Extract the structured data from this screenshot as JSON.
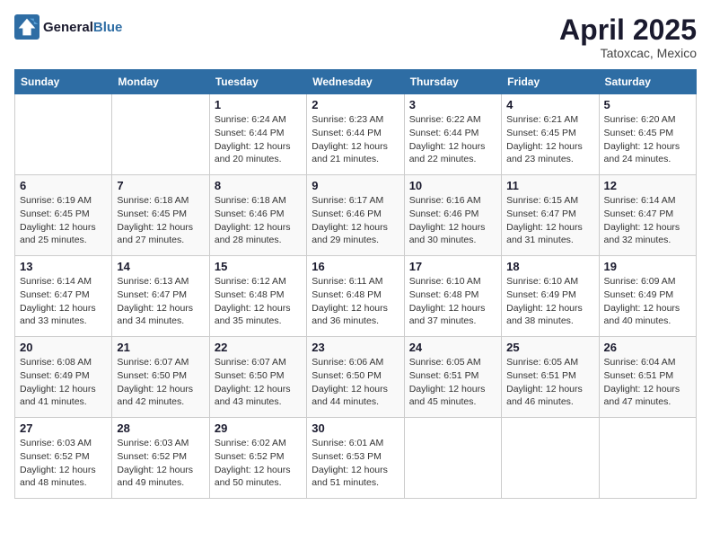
{
  "header": {
    "logo_line1": "General",
    "logo_line2": "Blue",
    "month": "April 2025",
    "location": "Tatoxcac, Mexico"
  },
  "days_of_week": [
    "Sunday",
    "Monday",
    "Tuesday",
    "Wednesday",
    "Thursday",
    "Friday",
    "Saturday"
  ],
  "weeks": [
    [
      {
        "day": "",
        "sunrise": "",
        "sunset": "",
        "daylight": ""
      },
      {
        "day": "",
        "sunrise": "",
        "sunset": "",
        "daylight": ""
      },
      {
        "day": "1",
        "sunrise": "Sunrise: 6:24 AM",
        "sunset": "Sunset: 6:44 PM",
        "daylight": "Daylight: 12 hours and 20 minutes."
      },
      {
        "day": "2",
        "sunrise": "Sunrise: 6:23 AM",
        "sunset": "Sunset: 6:44 PM",
        "daylight": "Daylight: 12 hours and 21 minutes."
      },
      {
        "day": "3",
        "sunrise": "Sunrise: 6:22 AM",
        "sunset": "Sunset: 6:44 PM",
        "daylight": "Daylight: 12 hours and 22 minutes."
      },
      {
        "day": "4",
        "sunrise": "Sunrise: 6:21 AM",
        "sunset": "Sunset: 6:45 PM",
        "daylight": "Daylight: 12 hours and 23 minutes."
      },
      {
        "day": "5",
        "sunrise": "Sunrise: 6:20 AM",
        "sunset": "Sunset: 6:45 PM",
        "daylight": "Daylight: 12 hours and 24 minutes."
      }
    ],
    [
      {
        "day": "6",
        "sunrise": "Sunrise: 6:19 AM",
        "sunset": "Sunset: 6:45 PM",
        "daylight": "Daylight: 12 hours and 25 minutes."
      },
      {
        "day": "7",
        "sunrise": "Sunrise: 6:18 AM",
        "sunset": "Sunset: 6:45 PM",
        "daylight": "Daylight: 12 hours and 27 minutes."
      },
      {
        "day": "8",
        "sunrise": "Sunrise: 6:18 AM",
        "sunset": "Sunset: 6:46 PM",
        "daylight": "Daylight: 12 hours and 28 minutes."
      },
      {
        "day": "9",
        "sunrise": "Sunrise: 6:17 AM",
        "sunset": "Sunset: 6:46 PM",
        "daylight": "Daylight: 12 hours and 29 minutes."
      },
      {
        "day": "10",
        "sunrise": "Sunrise: 6:16 AM",
        "sunset": "Sunset: 6:46 PM",
        "daylight": "Daylight: 12 hours and 30 minutes."
      },
      {
        "day": "11",
        "sunrise": "Sunrise: 6:15 AM",
        "sunset": "Sunset: 6:47 PM",
        "daylight": "Daylight: 12 hours and 31 minutes."
      },
      {
        "day": "12",
        "sunrise": "Sunrise: 6:14 AM",
        "sunset": "Sunset: 6:47 PM",
        "daylight": "Daylight: 12 hours and 32 minutes."
      }
    ],
    [
      {
        "day": "13",
        "sunrise": "Sunrise: 6:14 AM",
        "sunset": "Sunset: 6:47 PM",
        "daylight": "Daylight: 12 hours and 33 minutes."
      },
      {
        "day": "14",
        "sunrise": "Sunrise: 6:13 AM",
        "sunset": "Sunset: 6:47 PM",
        "daylight": "Daylight: 12 hours and 34 minutes."
      },
      {
        "day": "15",
        "sunrise": "Sunrise: 6:12 AM",
        "sunset": "Sunset: 6:48 PM",
        "daylight": "Daylight: 12 hours and 35 minutes."
      },
      {
        "day": "16",
        "sunrise": "Sunrise: 6:11 AM",
        "sunset": "Sunset: 6:48 PM",
        "daylight": "Daylight: 12 hours and 36 minutes."
      },
      {
        "day": "17",
        "sunrise": "Sunrise: 6:10 AM",
        "sunset": "Sunset: 6:48 PM",
        "daylight": "Daylight: 12 hours and 37 minutes."
      },
      {
        "day": "18",
        "sunrise": "Sunrise: 6:10 AM",
        "sunset": "Sunset: 6:49 PM",
        "daylight": "Daylight: 12 hours and 38 minutes."
      },
      {
        "day": "19",
        "sunrise": "Sunrise: 6:09 AM",
        "sunset": "Sunset: 6:49 PM",
        "daylight": "Daylight: 12 hours and 40 minutes."
      }
    ],
    [
      {
        "day": "20",
        "sunrise": "Sunrise: 6:08 AM",
        "sunset": "Sunset: 6:49 PM",
        "daylight": "Daylight: 12 hours and 41 minutes."
      },
      {
        "day": "21",
        "sunrise": "Sunrise: 6:07 AM",
        "sunset": "Sunset: 6:50 PM",
        "daylight": "Daylight: 12 hours and 42 minutes."
      },
      {
        "day": "22",
        "sunrise": "Sunrise: 6:07 AM",
        "sunset": "Sunset: 6:50 PM",
        "daylight": "Daylight: 12 hours and 43 minutes."
      },
      {
        "day": "23",
        "sunrise": "Sunrise: 6:06 AM",
        "sunset": "Sunset: 6:50 PM",
        "daylight": "Daylight: 12 hours and 44 minutes."
      },
      {
        "day": "24",
        "sunrise": "Sunrise: 6:05 AM",
        "sunset": "Sunset: 6:51 PM",
        "daylight": "Daylight: 12 hours and 45 minutes."
      },
      {
        "day": "25",
        "sunrise": "Sunrise: 6:05 AM",
        "sunset": "Sunset: 6:51 PM",
        "daylight": "Daylight: 12 hours and 46 minutes."
      },
      {
        "day": "26",
        "sunrise": "Sunrise: 6:04 AM",
        "sunset": "Sunset: 6:51 PM",
        "daylight": "Daylight: 12 hours and 47 minutes."
      }
    ],
    [
      {
        "day": "27",
        "sunrise": "Sunrise: 6:03 AM",
        "sunset": "Sunset: 6:52 PM",
        "daylight": "Daylight: 12 hours and 48 minutes."
      },
      {
        "day": "28",
        "sunrise": "Sunrise: 6:03 AM",
        "sunset": "Sunset: 6:52 PM",
        "daylight": "Daylight: 12 hours and 49 minutes."
      },
      {
        "day": "29",
        "sunrise": "Sunrise: 6:02 AM",
        "sunset": "Sunset: 6:52 PM",
        "daylight": "Daylight: 12 hours and 50 minutes."
      },
      {
        "day": "30",
        "sunrise": "Sunrise: 6:01 AM",
        "sunset": "Sunset: 6:53 PM",
        "daylight": "Daylight: 12 hours and 51 minutes."
      },
      {
        "day": "",
        "sunrise": "",
        "sunset": "",
        "daylight": ""
      },
      {
        "day": "",
        "sunrise": "",
        "sunset": "",
        "daylight": ""
      },
      {
        "day": "",
        "sunrise": "",
        "sunset": "",
        "daylight": ""
      }
    ]
  ]
}
